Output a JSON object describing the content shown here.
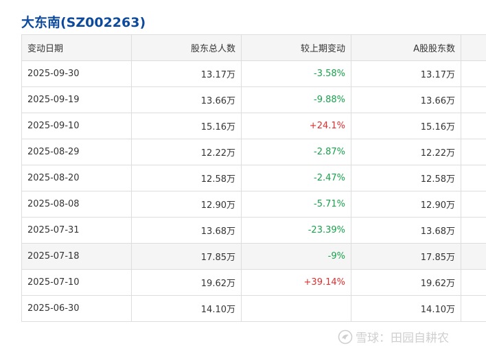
{
  "title": "大东南(SZ002263)",
  "table": {
    "headers": [
      "变动日期",
      "股东总人数",
      "较上期变动",
      "A股股东数",
      ""
    ],
    "rows": [
      {
        "date": "2025-09-30",
        "total": "13.17万",
        "change": "-3.58%",
        "a_share": "13.17万",
        "trend": "down"
      },
      {
        "date": "2025-09-19",
        "total": "13.66万",
        "change": "-9.88%",
        "a_share": "13.66万",
        "trend": "down"
      },
      {
        "date": "2025-09-10",
        "total": "15.16万",
        "change": "+24.1%",
        "a_share": "15.16万",
        "trend": "up"
      },
      {
        "date": "2025-08-29",
        "total": "12.22万",
        "change": "-2.87%",
        "a_share": "12.22万",
        "trend": "down"
      },
      {
        "date": "2025-08-20",
        "total": "12.58万",
        "change": "-2.47%",
        "a_share": "12.58万",
        "trend": "down"
      },
      {
        "date": "2025-08-08",
        "total": "12.90万",
        "change": "-5.71%",
        "a_share": "12.90万",
        "trend": "down"
      },
      {
        "date": "2025-07-31",
        "total": "13.68万",
        "change": "-23.39%",
        "a_share": "13.68万",
        "trend": "down"
      },
      {
        "date": "2025-07-18",
        "total": "17.85万",
        "change": "-9%",
        "a_share": "17.85万",
        "trend": "down",
        "highlighted": true
      },
      {
        "date": "2025-07-10",
        "total": "19.62万",
        "change": "+39.14%",
        "a_share": "19.62万",
        "trend": "up"
      },
      {
        "date": "2025-06-30",
        "total": "14.10万",
        "change": "",
        "a_share": "14.10万",
        "trend": ""
      }
    ]
  },
  "colors": {
    "title": "#0d4a9c",
    "up": "#e02d2d",
    "down": "#16a34a",
    "header_bg": "#f5f5f5",
    "border": "#dddddd"
  },
  "watermark": {
    "text": "雪球：田园自耕农",
    "icon": "snowball-logo-icon"
  }
}
